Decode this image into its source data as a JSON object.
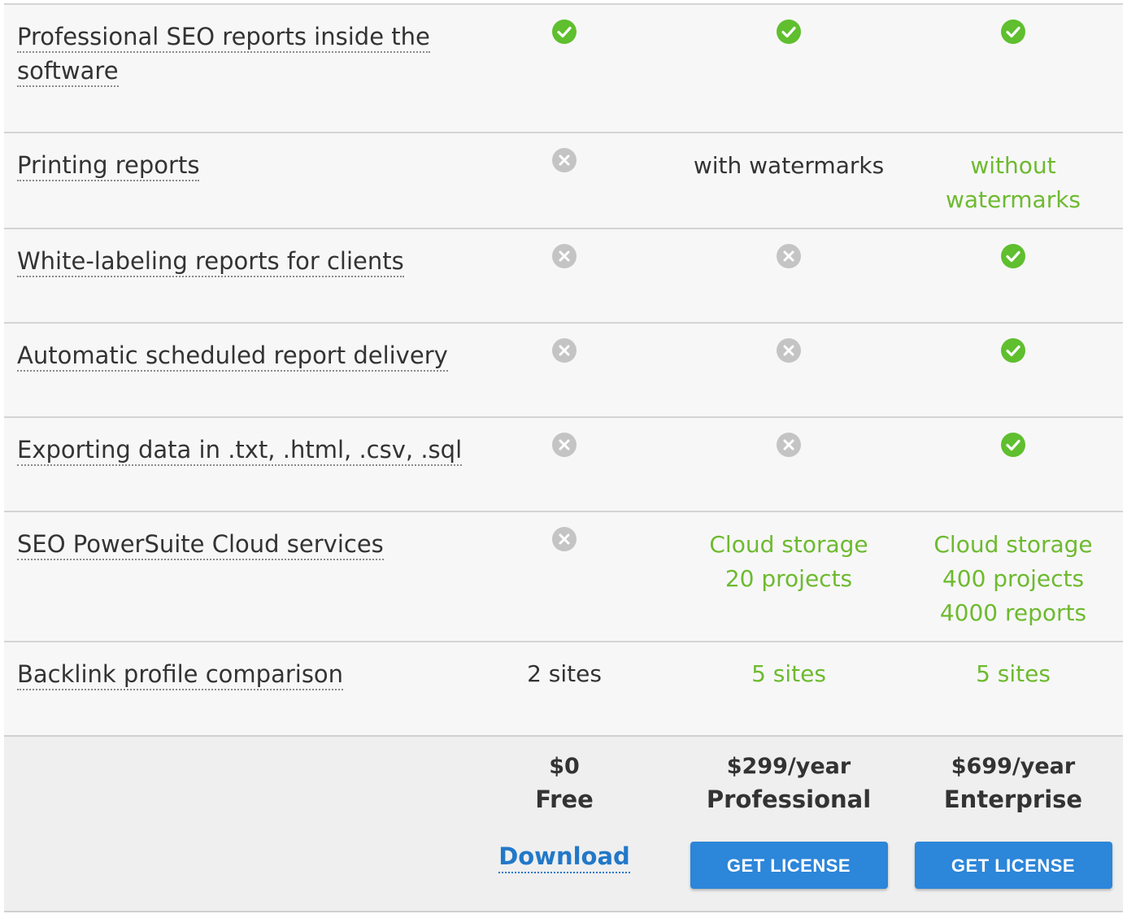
{
  "colors": {
    "accent_green": "#6dba2f",
    "check_green": "#5fbf2e",
    "cross_gray": "#c4c4c4",
    "link_blue": "#2278c8",
    "button_blue": "#2c86d9",
    "row_bg": "#f7f7f7",
    "footer_bg": "#efefef"
  },
  "rows": [
    {
      "feature": "Professional SEO reports inside the software",
      "free": {
        "icon": "check-icon"
      },
      "professional": {
        "icon": "check-icon"
      },
      "enterprise": {
        "icon": "check-icon"
      }
    },
    {
      "feature": "Printing reports",
      "free": {
        "icon": "cross-icon"
      },
      "professional": {
        "text": [
          "with watermarks"
        ],
        "color": "dark"
      },
      "enterprise": {
        "text": [
          "without",
          "watermarks"
        ],
        "color": "green"
      }
    },
    {
      "feature": "White-labeling reports for clients",
      "free": {
        "icon": "cross-icon"
      },
      "professional": {
        "icon": "cross-icon"
      },
      "enterprise": {
        "icon": "check-icon"
      }
    },
    {
      "feature": "Automatic scheduled report delivery",
      "free": {
        "icon": "cross-icon"
      },
      "professional": {
        "icon": "cross-icon"
      },
      "enterprise": {
        "icon": "check-icon"
      }
    },
    {
      "feature": "Exporting data in .txt, .html, .csv, .sql",
      "free": {
        "icon": "cross-icon"
      },
      "professional": {
        "icon": "cross-icon"
      },
      "enterprise": {
        "icon": "check-icon"
      }
    },
    {
      "feature": "SEO PowerSuite Cloud services",
      "free": {
        "icon": "cross-icon"
      },
      "professional": {
        "text": [
          "Cloud storage",
          "20 projects"
        ],
        "color": "green"
      },
      "enterprise": {
        "text": [
          "Cloud storage",
          "400 projects",
          "4000 reports"
        ],
        "color": "green"
      }
    },
    {
      "feature": "Backlink profile comparison",
      "free": {
        "text": [
          "2 sites"
        ],
        "color": "dark"
      },
      "professional": {
        "text": [
          "5 sites"
        ],
        "color": "green"
      },
      "enterprise": {
        "text": [
          "5 sites"
        ],
        "color": "green"
      }
    }
  ],
  "plans": {
    "free": {
      "price": "$0",
      "name": "Free",
      "action": "Download"
    },
    "professional": {
      "price": "$299/year",
      "name": "Professional",
      "action": "GET LICENSE"
    },
    "enterprise": {
      "price": "$699/year",
      "name": "Enterprise",
      "action": "GET LICENSE"
    }
  }
}
